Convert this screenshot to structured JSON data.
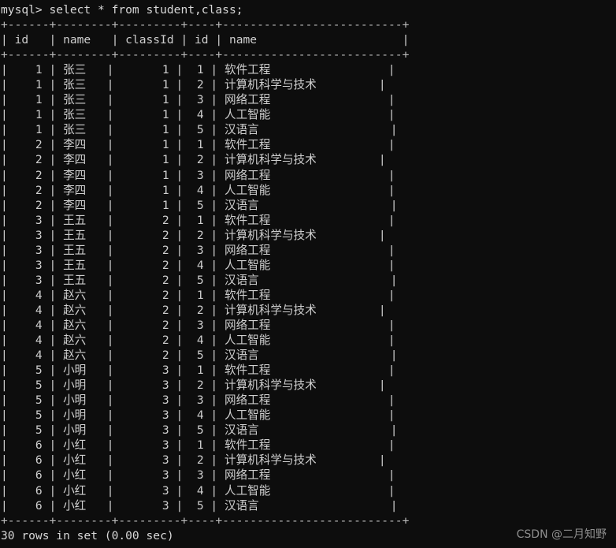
{
  "terminal": {
    "prompt": "mysql> ",
    "command": "select * from student,class;",
    "prompt_line": "mysql> select * from student,class;",
    "status_line": "30 rows in set (0.00 sec)",
    "row_count": 30,
    "elapsed": "0.00 sec",
    "background_color": "#0d0d0d",
    "text_color": "#cfcfcf",
    "rule_color": "#b9b9b9"
  },
  "watermark": {
    "text": "CSDN @二月知野"
  },
  "result_table": {
    "separator": "+------+--------+---------+----+--------------------------+",
    "header_line": "| id   | name   | classId | id | name                     |",
    "columns": [
      {
        "label": "id",
        "width": 6,
        "align": "right",
        "source": "student"
      },
      {
        "label": "name",
        "width": 8,
        "align": "left",
        "source": "student"
      },
      {
        "label": "classId",
        "width": 9,
        "align": "right",
        "source": "student"
      },
      {
        "label": "id",
        "width": 4,
        "align": "right",
        "source": "class"
      },
      {
        "label": "name",
        "width": 26,
        "align": "left",
        "source": "class"
      }
    ],
    "rows": [
      {
        "student_id": "1",
        "student_name": "张三",
        "classId": "1",
        "class_id": "1",
        "class_name": "软件工程"
      },
      {
        "student_id": "1",
        "student_name": "张三",
        "classId": "1",
        "class_id": "2",
        "class_name": "计算机科学与技术"
      },
      {
        "student_id": "1",
        "student_name": "张三",
        "classId": "1",
        "class_id": "3",
        "class_name": "网络工程"
      },
      {
        "student_id": "1",
        "student_name": "张三",
        "classId": "1",
        "class_id": "4",
        "class_name": "人工智能"
      },
      {
        "student_id": "1",
        "student_name": "张三",
        "classId": "1",
        "class_id": "5",
        "class_name": "汉语言"
      },
      {
        "student_id": "2",
        "student_name": "李四",
        "classId": "1",
        "class_id": "1",
        "class_name": "软件工程"
      },
      {
        "student_id": "2",
        "student_name": "李四",
        "classId": "1",
        "class_id": "2",
        "class_name": "计算机科学与技术"
      },
      {
        "student_id": "2",
        "student_name": "李四",
        "classId": "1",
        "class_id": "3",
        "class_name": "网络工程"
      },
      {
        "student_id": "2",
        "student_name": "李四",
        "classId": "1",
        "class_id": "4",
        "class_name": "人工智能"
      },
      {
        "student_id": "2",
        "student_name": "李四",
        "classId": "1",
        "class_id": "5",
        "class_name": "汉语言"
      },
      {
        "student_id": "3",
        "student_name": "王五",
        "classId": "2",
        "class_id": "1",
        "class_name": "软件工程"
      },
      {
        "student_id": "3",
        "student_name": "王五",
        "classId": "2",
        "class_id": "2",
        "class_name": "计算机科学与技术"
      },
      {
        "student_id": "3",
        "student_name": "王五",
        "classId": "2",
        "class_id": "3",
        "class_name": "网络工程"
      },
      {
        "student_id": "3",
        "student_name": "王五",
        "classId": "2",
        "class_id": "4",
        "class_name": "人工智能"
      },
      {
        "student_id": "3",
        "student_name": "王五",
        "classId": "2",
        "class_id": "5",
        "class_name": "汉语言"
      },
      {
        "student_id": "4",
        "student_name": "赵六",
        "classId": "2",
        "class_id": "1",
        "class_name": "软件工程"
      },
      {
        "student_id": "4",
        "student_name": "赵六",
        "classId": "2",
        "class_id": "2",
        "class_name": "计算机科学与技术"
      },
      {
        "student_id": "4",
        "student_name": "赵六",
        "classId": "2",
        "class_id": "3",
        "class_name": "网络工程"
      },
      {
        "student_id": "4",
        "student_name": "赵六",
        "classId": "2",
        "class_id": "4",
        "class_name": "人工智能"
      },
      {
        "student_id": "4",
        "student_name": "赵六",
        "classId": "2",
        "class_id": "5",
        "class_name": "汉语言"
      },
      {
        "student_id": "5",
        "student_name": "小明",
        "classId": "3",
        "class_id": "1",
        "class_name": "软件工程"
      },
      {
        "student_id": "5",
        "student_name": "小明",
        "classId": "3",
        "class_id": "2",
        "class_name": "计算机科学与技术"
      },
      {
        "student_id": "5",
        "student_name": "小明",
        "classId": "3",
        "class_id": "3",
        "class_name": "网络工程"
      },
      {
        "student_id": "5",
        "student_name": "小明",
        "classId": "3",
        "class_id": "4",
        "class_name": "人工智能"
      },
      {
        "student_id": "5",
        "student_name": "小明",
        "classId": "3",
        "class_id": "5",
        "class_name": "汉语言"
      },
      {
        "student_id": "6",
        "student_name": "小红",
        "classId": "3",
        "class_id": "1",
        "class_name": "软件工程"
      },
      {
        "student_id": "6",
        "student_name": "小红",
        "classId": "3",
        "class_id": "2",
        "class_name": "计算机科学与技术"
      },
      {
        "student_id": "6",
        "student_name": "小红",
        "classId": "3",
        "class_id": "3",
        "class_name": "网络工程"
      },
      {
        "student_id": "6",
        "student_name": "小红",
        "classId": "3",
        "class_id": "4",
        "class_name": "人工智能"
      },
      {
        "student_id": "6",
        "student_name": "小红",
        "classId": "3",
        "class_id": "5",
        "class_name": "汉语言"
      }
    ]
  }
}
